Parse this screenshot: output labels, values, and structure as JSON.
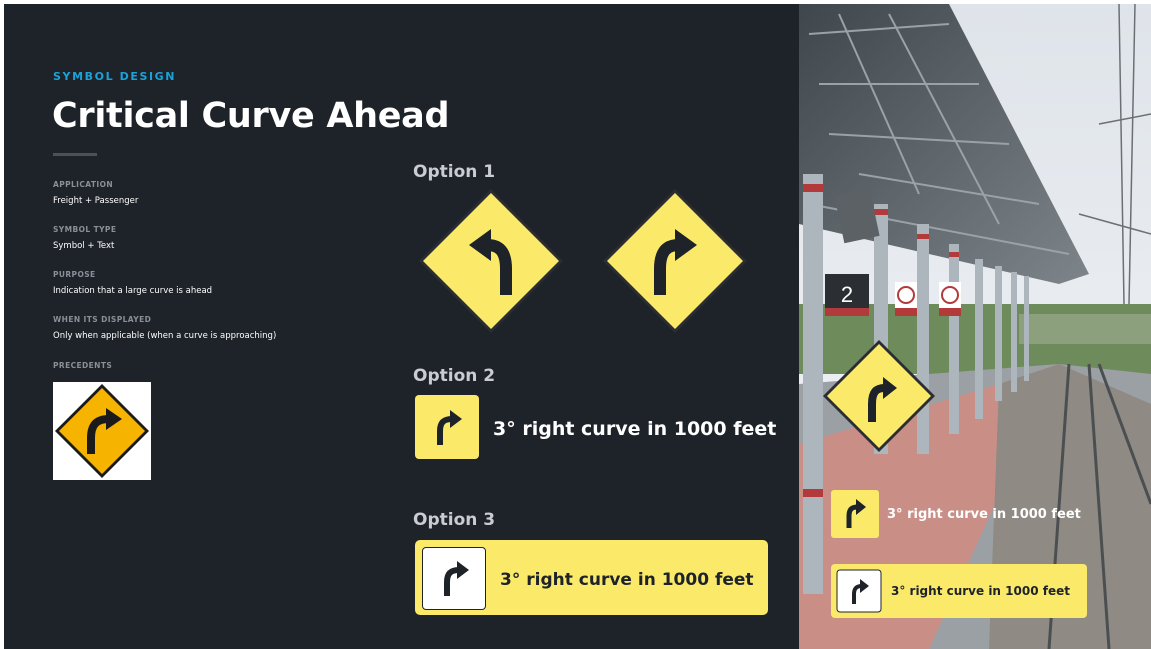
{
  "slide": {
    "eyebrow": "SYMBOL DESIGN",
    "title": "Critical Curve Ahead",
    "info": [
      {
        "label": "APPLICATION",
        "value": "Freight + Passenger"
      },
      {
        "label": "SYMBOL TYPE",
        "value": "Symbol + Text"
      },
      {
        "label": "PURPOSE",
        "value": "Indication that a large curve is ahead"
      },
      {
        "label": "WHEN ITS DISPLAYED",
        "value": "Only when applicable (when a curve is approaching)"
      },
      {
        "label": "PRECEDENTS",
        "value": ""
      }
    ]
  },
  "options": [
    {
      "label": "Option 1"
    },
    {
      "label": "Option 2",
      "text": "3° right curve in 1000 feet"
    },
    {
      "label": "Option 3",
      "text": "3° right curve in 1000 feet"
    }
  ],
  "photo": {
    "platform_number": "2",
    "sign_text_1": "3° right curve in 1000 feet",
    "sign_text_2": "3° right curve in 1000 feet"
  },
  "colors": {
    "background": "#1e2229",
    "accent": "#1aa3d9",
    "sign_yellow": "#fbea6a",
    "precedent_orange": "#f6b400"
  },
  "icons": [
    "left-curve-arrow-icon",
    "right-curve-arrow-icon"
  ]
}
